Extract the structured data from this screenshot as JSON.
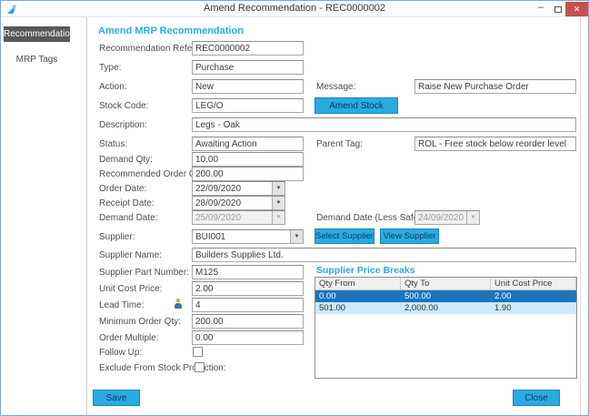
{
  "window": {
    "title": "Amend Recommendation - REC0000002",
    "minimize_glyph": "–",
    "close_glyph": "✕"
  },
  "sidebar": {
    "items": [
      {
        "label": "Recommendation",
        "selected": true
      },
      {
        "label": "MRP Tags",
        "selected": false
      }
    ]
  },
  "main": {
    "heading": "Amend MRP Recommendation",
    "fields": {
      "recommendation_reference": {
        "label": "Recommendation Reference:",
        "value": "REC0000002"
      },
      "type": {
        "label": "Type:",
        "value": "Purchase"
      },
      "action": {
        "label": "Action:",
        "value": "New"
      },
      "message": {
        "label": "Message:",
        "value": "Raise New Purchase Order"
      },
      "stock_code": {
        "label": "Stock Code:",
        "value": "LEG/O"
      },
      "description": {
        "label": "Description:",
        "value": "Legs - Oak"
      },
      "status": {
        "label": "Status:",
        "value": "Awaiting Action"
      },
      "parent_tag": {
        "label": "Parent Tag:",
        "value": "ROL - Free stock below reorder level"
      },
      "demand_qty": {
        "label": "Demand Qty:",
        "value": "10.00"
      },
      "recommended_order_qty": {
        "label": "Recommended Order Qty:",
        "value": "200.00"
      },
      "order_date": {
        "label": "Order Date:",
        "value": "22/09/2020"
      },
      "receipt_date": {
        "label": "Receipt Date:",
        "value": "28/09/2020"
      },
      "demand_date": {
        "label": "Demand Date:",
        "value": "25/09/2020",
        "disabled": true
      },
      "demand_date_less_safety": {
        "label": "Demand Date (Less Safety):",
        "value": "24/09/2020",
        "disabled": true
      },
      "supplier": {
        "label": "Supplier:",
        "value": "BUI001"
      },
      "supplier_name": {
        "label": "Supplier Name:",
        "value": "Builders Supplies Ltd."
      },
      "supplier_part_number": {
        "label": "Supplier Part Number:",
        "value": "M125"
      },
      "unit_cost_price": {
        "label": "Unit Cost Price:",
        "value": "2.00"
      },
      "lead_time": {
        "label": "Lead Time:",
        "value": "4"
      },
      "minimum_order_qty": {
        "label": "Minimum Order Qty:",
        "value": "200.00"
      },
      "order_multiple": {
        "label": "Order Multiple:",
        "value": "0.00"
      },
      "follow_up": {
        "label": "Follow Up:",
        "checked": false
      },
      "exclude_from_stock_projection": {
        "label": "Exclude From Stock Projection:",
        "checked": false
      }
    },
    "buttons": {
      "amend_stock": "Amend Stock",
      "select_supplier": "Select Supplier",
      "view_supplier": "View Supplier",
      "save": "Save",
      "close": "Close"
    },
    "price_breaks": {
      "heading": "Supplier Price Breaks",
      "columns": [
        "Qty From",
        "Qty To",
        "Unit Cost Price"
      ],
      "rows": [
        [
          "0.00",
          "500.00",
          "2.00"
        ],
        [
          "501.00",
          "2,000.00",
          "1.90"
        ]
      ],
      "selected_row_index": 0
    },
    "colors": {
      "accent": "#29ABE2",
      "heading_text": "#29ABE2",
      "selected_row_bg": "#1B75BC",
      "alt_row_bg": "#CDE9F8",
      "selected_tab_bg": "#58595B",
      "close_button_bg": "#C75050"
    }
  }
}
